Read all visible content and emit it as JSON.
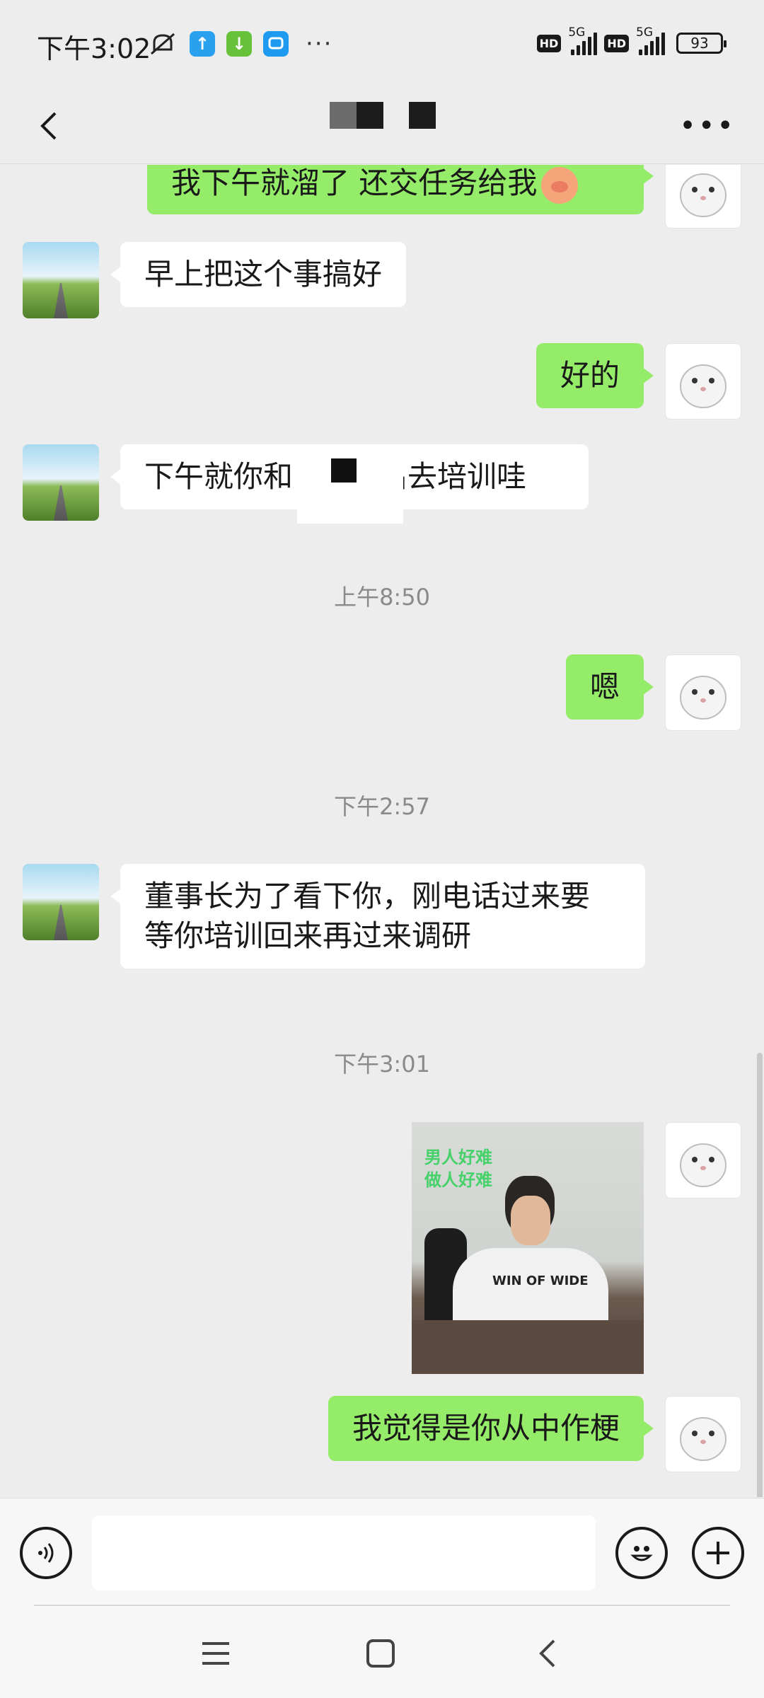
{
  "status_bar": {
    "time": "下午3:02",
    "battery": "93",
    "network": "5G",
    "hd": "HD",
    "more": "···"
  },
  "header": {
    "title": ""
  },
  "messages": [
    {
      "side": "out",
      "text": "我下午就溜了  还交任务给我"
    },
    {
      "side": "in",
      "text": "早上把这个事搞好"
    },
    {
      "side": "out",
      "text": "好的"
    },
    {
      "side": "in",
      "text_before": "下午就你和",
      "text_after": "出去培训哇"
    },
    {
      "timestamp": "上午8:50"
    },
    {
      "side": "out",
      "text": "嗯"
    },
    {
      "timestamp": "下午2:57"
    },
    {
      "side": "in",
      "text_line1": "董事长为了看下你，刚电话过来要",
      "text_line2": "等你培训回来再过来调研"
    },
    {
      "timestamp": "下午3:01"
    },
    {
      "side": "out",
      "type": "image",
      "caption_line1": "男人好难",
      "caption_line2": "做人好难",
      "shirt_text": "WIN OF WIDE"
    },
    {
      "side": "out",
      "text": "我觉得是你从中作梗"
    }
  ],
  "input": {
    "value": "",
    "placeholder": ""
  },
  "colors": {
    "background": "#ededed",
    "outgoing_bubble": "#95ec69",
    "incoming_bubble": "#ffffff"
  }
}
